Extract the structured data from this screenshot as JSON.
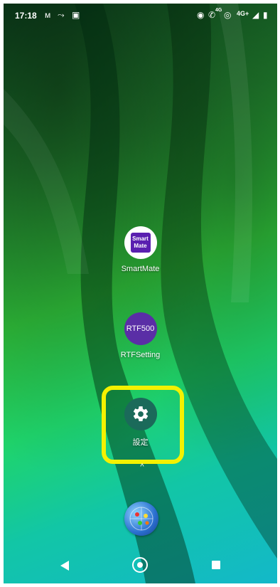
{
  "status_bar": {
    "time": "17:18",
    "network_label": "4G+",
    "volte_label": "4G",
    "icons": [
      "m-icon",
      "sync-icon",
      "screenshot-icon",
      "eye-icon",
      "call-icon",
      "hotspot-icon",
      "signal-icon",
      "battery-icon"
    ]
  },
  "apps": [
    {
      "name": "SmartMate",
      "icon_text_line1": "Smart",
      "icon_text_line2": "Mate",
      "icon_color": "#5a1fb0"
    },
    {
      "name": "RTFSetting",
      "icon_text": "RTF500",
      "icon_color": "#5a2ea6"
    },
    {
      "name": "設定",
      "icon": "gear-icon",
      "icon_color": "#1b6a5a"
    }
  ],
  "dock": {
    "icon": "globe-app-icon"
  },
  "highlight_color": "#f4f100",
  "nav_bar": {
    "back": "back-icon",
    "home": "home-icon",
    "recents": "recents-icon"
  }
}
